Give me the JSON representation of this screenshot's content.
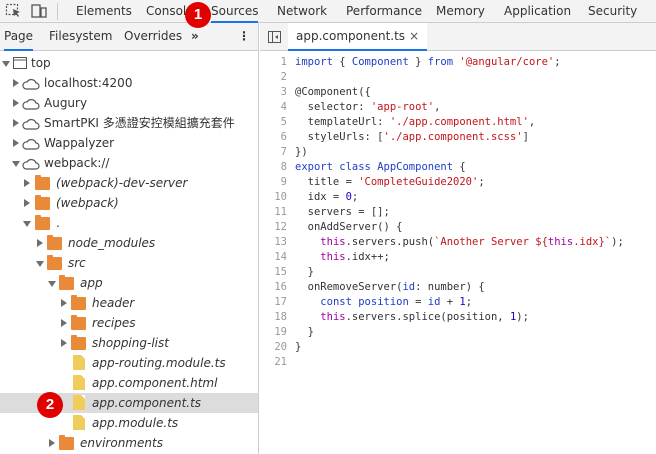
{
  "topbar": {
    "tabs": [
      "Elements",
      "Console",
      "Sources",
      "Network",
      "Performance",
      "Memory",
      "Application",
      "Security"
    ],
    "active_tab": "Sources",
    "icons": [
      "inspect-element-icon",
      "device-toolbar-icon"
    ]
  },
  "navigator": {
    "tabs": [
      "Page",
      "Filesystem",
      "Overrides"
    ],
    "active_tab": "Page",
    "more_glyph": "»",
    "menu_glyph": "⋮",
    "tree": [
      {
        "label": "top",
        "kind": "frame",
        "expanded": true
      },
      {
        "label": "localhost:4200",
        "kind": "cloud",
        "expanded": false
      },
      {
        "label": "Augury",
        "kind": "cloud",
        "expanded": false
      },
      {
        "label": "SmartPKI 多憑證安控模組擴充套件",
        "kind": "cloud",
        "expanded": false
      },
      {
        "label": "Wappalyzer",
        "kind": "cloud",
        "expanded": false
      },
      {
        "label": "webpack://",
        "kind": "cloud",
        "expanded": true
      },
      {
        "label": "(webpack)-dev-server",
        "kind": "folder",
        "expanded": false
      },
      {
        "label": "(webpack)",
        "kind": "folder",
        "expanded": false
      },
      {
        "label": ".",
        "kind": "folder",
        "expanded": true
      },
      {
        "label": "node_modules",
        "kind": "folder",
        "expanded": false
      },
      {
        "label": "src",
        "kind": "folder",
        "expanded": true
      },
      {
        "label": "app",
        "kind": "folder",
        "expanded": true
      },
      {
        "label": "header",
        "kind": "folder",
        "expanded": false
      },
      {
        "label": "recipes",
        "kind": "folder",
        "expanded": false
      },
      {
        "label": "shopping-list",
        "kind": "folder",
        "expanded": false
      },
      {
        "label": "app-routing.module.ts",
        "kind": "file"
      },
      {
        "label": "app.component.html",
        "kind": "file"
      },
      {
        "label": "app.component.ts",
        "kind": "file",
        "selected": true
      },
      {
        "label": "app.module.ts",
        "kind": "file"
      },
      {
        "label": "environments",
        "kind": "folder",
        "expanded": false
      }
    ]
  },
  "editor": {
    "open_file": "app.component.ts",
    "close_glyph": "×",
    "lines": [
      "1",
      "2",
      "3",
      "4",
      "5",
      "6",
      "7",
      "8",
      "9",
      "10",
      "11",
      "12",
      "13",
      "14",
      "15",
      "16",
      "17",
      "18",
      "19",
      "20",
      "21"
    ],
    "code": {
      "l1": [
        "import",
        " { ",
        "Component",
        " } ",
        "from",
        " ",
        "'@angular/core'",
        ";"
      ],
      "l3": [
        "@Component({"
      ],
      "l4": [
        "  selector: ",
        "'app-root'",
        ","
      ],
      "l5": [
        "  templateUrl: ",
        "'./app.component.html'",
        ","
      ],
      "l6": [
        "  styleUrls: [",
        "'./app.component.scss'",
        "]"
      ],
      "l7": [
        "})"
      ],
      "l8": [
        "export",
        " ",
        "class",
        " ",
        "AppComponent",
        " {"
      ],
      "l9": [
        "  title = ",
        "'CompleteGuide2020'",
        ";"
      ],
      "l10": [
        "  idx = ",
        "0",
        ";"
      ],
      "l11": [
        "  servers = [];"
      ],
      "l12": [
        "  onAddServer() {"
      ],
      "l13": [
        "    ",
        "this",
        ".servers.push(",
        "`Another Server ${",
        "this",
        ".idx}`",
        ");"
      ],
      "l14": [
        "    ",
        "this",
        ".idx++;"
      ],
      "l15": [
        "  }"
      ],
      "l16": [
        "  onRemoveServer(",
        "id",
        ": number) {"
      ],
      "l17": [
        "    ",
        "const",
        " ",
        "position",
        " = ",
        "id",
        " + ",
        "1",
        ";"
      ],
      "l18": [
        "    ",
        "this",
        ".servers.splice(position, ",
        "1",
        ");"
      ],
      "l19": [
        "  }"
      ],
      "l20": [
        "}"
      ]
    }
  },
  "annotations": {
    "badge1": "1",
    "badge2": "2"
  },
  "colors": {
    "accent": "#1a73e8",
    "badge": "#e00000",
    "folder": "#e98a38",
    "file": "#f0cc5a",
    "keyword": "#1f3ec4",
    "string": "#c1151b"
  }
}
